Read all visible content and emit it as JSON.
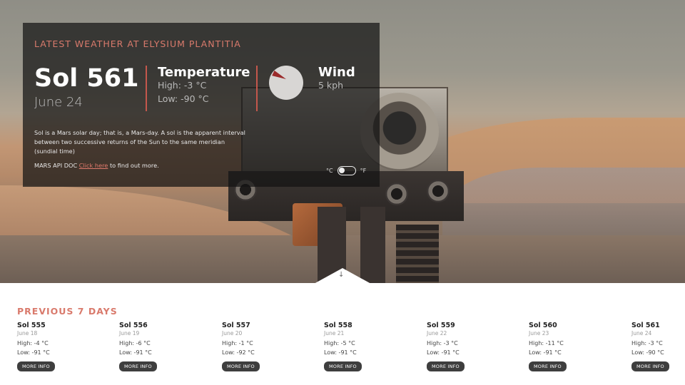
{
  "current": {
    "heading": "LATEST WEATHER AT ELYSIUM PLANTITIA",
    "sol": "Sol 561",
    "date": "June 24",
    "temperature": {
      "title": "Temperature",
      "high": "High: -3 °C",
      "low": "Low: -90 °C"
    },
    "wind": {
      "title": "Wind",
      "speed": "5 kph",
      "direction_icon": "wind-direction-dial"
    },
    "description": "Sol is a Mars solar day; that is, a Mars-day. A sol is the apparent interval between two successive returns of the Sun to the same meridian (sundial time)",
    "api_prefix": "MARS API DOC ",
    "api_link": "Click here",
    "api_suffix": " to find out more.",
    "unit_c": "°C",
    "unit_f": "°F"
  },
  "previous": {
    "heading": "PREVIOUS 7 DAYS",
    "button_label": "MORE INFO",
    "days": [
      {
        "sol": "Sol 555",
        "date": "June 18",
        "high": "High: -4 °C",
        "low": "Low: -91 °C"
      },
      {
        "sol": "Sol 556",
        "date": "June 19",
        "high": "High: -6 °C",
        "low": "Low: -91 °C"
      },
      {
        "sol": "Sol 557",
        "date": "June 20",
        "high": "High: -1 °C",
        "low": "Low: -92 °C"
      },
      {
        "sol": "Sol 558",
        "date": "June 21",
        "high": "High: -5 °C",
        "low": "Low: -91 °C"
      },
      {
        "sol": "Sol 559",
        "date": "June 22",
        "high": "High: -3 °C",
        "low": "Low: -91 °C"
      },
      {
        "sol": "Sol 560",
        "date": "June 23",
        "high": "High: -11 °C",
        "low": "Low: -91 °C"
      },
      {
        "sol": "Sol 561",
        "date": "June 24",
        "high": "High: -3 °C",
        "low": "Low: -90 °C"
      }
    ]
  },
  "colors": {
    "accent": "#d97a6c",
    "card_bg": "#141414",
    "button_bg": "#3e3e3e"
  }
}
